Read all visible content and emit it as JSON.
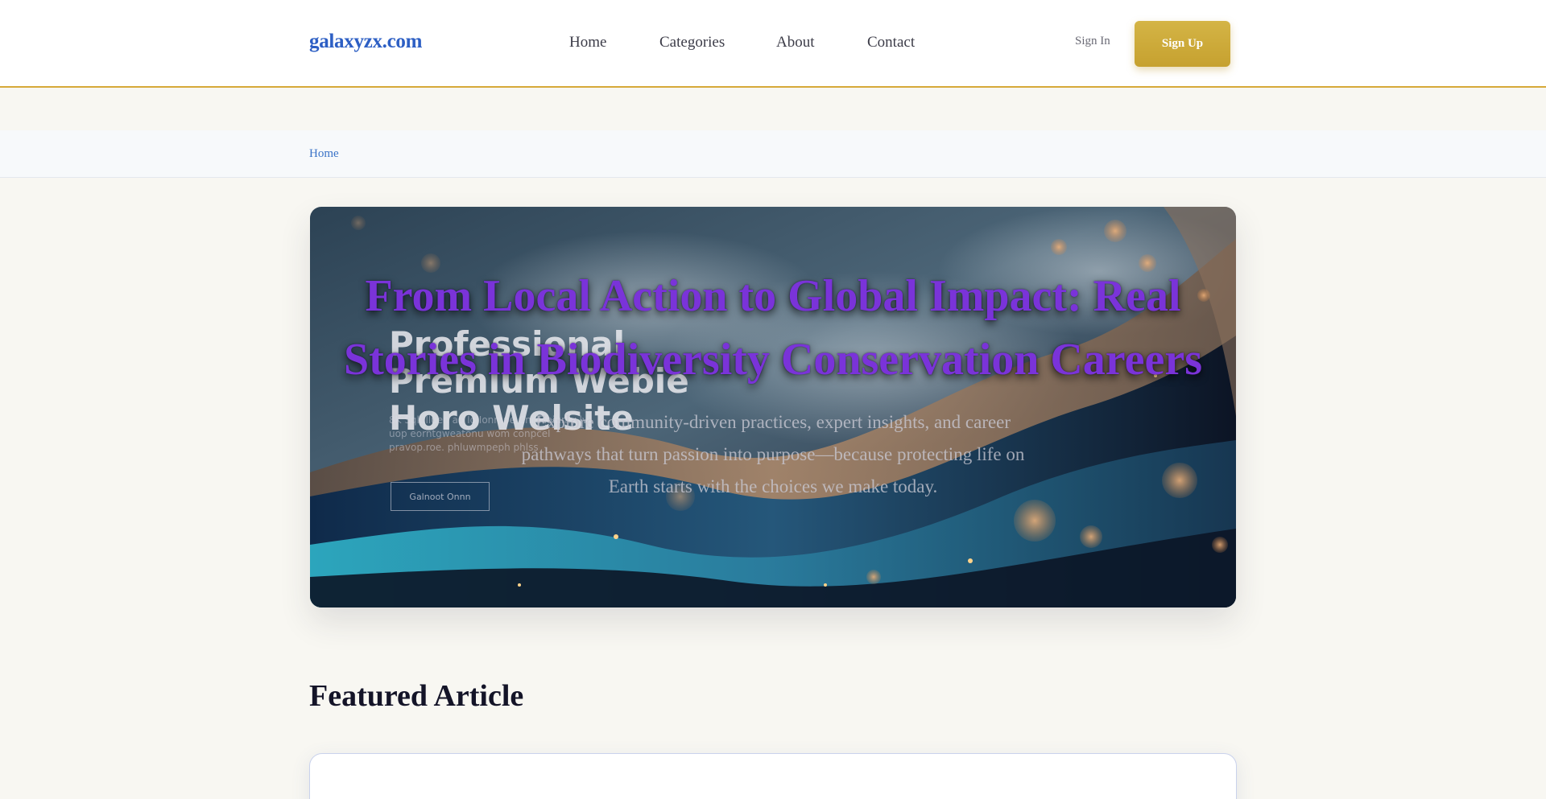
{
  "header": {
    "logo": "galaxyzx.com",
    "nav": [
      {
        "label": "Home"
      },
      {
        "label": "Categories"
      },
      {
        "label": "About"
      },
      {
        "label": "Contact"
      }
    ],
    "sign_in": "Sign In",
    "sign_up": "Sign Up"
  },
  "breadcrumb": {
    "home": "Home"
  },
  "hero": {
    "title": "From Local Action to Global Impact: Real Stories in Biodiversity Conservation Careers",
    "subtitle": "Explore community-driven practices, expert insights, and career pathways that turn passion into purpose—because protecting life on Earth starts with the choices we make today.",
    "image_text": {
      "headline": "Professional Premium Webie Horo Welsite",
      "caption": "8K Sqlulluen ao Io Ionmpe Cnrdcoiumy lv uop eorntgweatonu wom conpcel pravop.roe. phluwmpeph phlss",
      "button": "Galnoot Onnn"
    }
  },
  "featured": {
    "heading": "Featured Article"
  },
  "colors": {
    "brand_blue": "#2d5fc4",
    "accent_gold": "#c6a12f",
    "hero_title_purple": "#7a33d9"
  }
}
